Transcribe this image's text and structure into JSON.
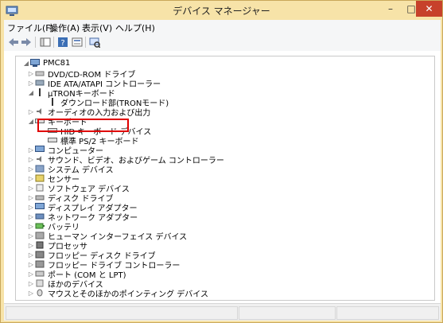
{
  "window": {
    "title": "デバイス マネージャー",
    "controls": {
      "minimize": "–",
      "maximize": "□",
      "close": "✕"
    }
  },
  "menu": {
    "items": [
      "ファイル(F)",
      "操作(A)",
      "表示(V)",
      "ヘルプ(H)"
    ]
  },
  "toolbar": {
    "icons": [
      "back-icon",
      "forward-icon",
      "show-hide-console-tree-icon",
      "help-icon",
      "properties-icon",
      "scan-hardware-icon"
    ]
  },
  "tree": {
    "root": "PMC81",
    "items": [
      {
        "label": "DVD/CD-ROM ドライブ",
        "expanded": false
      },
      {
        "label": "IDE ATA/ATAPI コントローラー",
        "expanded": false
      },
      {
        "label": "μTRONキーボード",
        "expanded": true
      },
      {
        "label": "ダウンロード部(TRONモード)",
        "child": true
      },
      {
        "label": "オーディオの入力および出力",
        "expanded": false
      },
      {
        "label": "キーボード",
        "expanded": true
      },
      {
        "label": "HID キーボード デバイス",
        "child": true,
        "highlighted": true
      },
      {
        "label": "標準 PS/2 キーボード",
        "child": true
      },
      {
        "label": "コンピューター",
        "expanded": false
      },
      {
        "label": "サウンド、ビデオ、およびゲーム コントローラー",
        "expanded": false
      },
      {
        "label": "システム デバイス",
        "expanded": false
      },
      {
        "label": "センサー",
        "expanded": false
      },
      {
        "label": "ソフトウェア デバイス",
        "expanded": false
      },
      {
        "label": "ディスク ドライブ",
        "expanded": false
      },
      {
        "label": "ディスプレイ アダプター",
        "expanded": false
      },
      {
        "label": "ネットワーク アダプター",
        "expanded": false
      },
      {
        "label": "バッテリ",
        "expanded": false
      },
      {
        "label": "ヒューマン インターフェイス デバイス",
        "expanded": false
      },
      {
        "label": "プロセッサ",
        "expanded": false
      },
      {
        "label": "フロッピー ディスク ドライブ",
        "expanded": false
      },
      {
        "label": "フロッピー ドライブ コントローラー",
        "expanded": false
      },
      {
        "label": "ポート (COM と LPT)",
        "expanded": false
      },
      {
        "label": "ほかのデバイス",
        "expanded": false
      },
      {
        "label": "マウスとそのほかのポインティング デバイス",
        "expanded": false
      }
    ]
  },
  "colors": {
    "titlebar": "#f7e3a8",
    "close": "#c7412b",
    "highlight": "#e00000"
  }
}
